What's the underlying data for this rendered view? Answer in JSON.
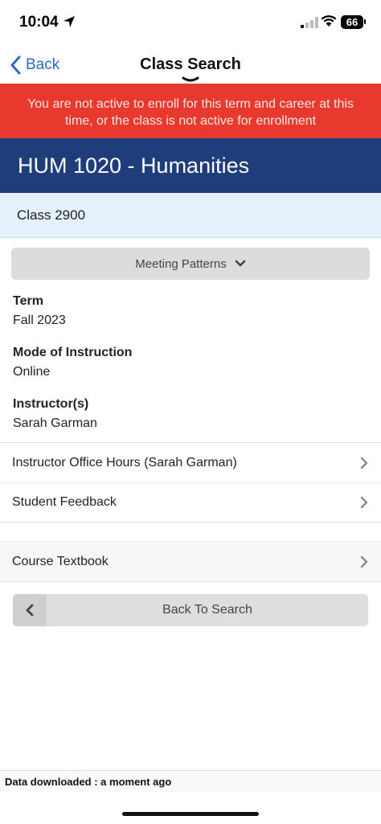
{
  "status": {
    "time": "10:04",
    "battery": "66"
  },
  "nav": {
    "back_label": "Back",
    "title": "Class Search"
  },
  "alert": {
    "message": "You are not active to enroll for this term and career at this time, or the class is not active for enrollment"
  },
  "course": {
    "title": "HUM 1020 - Humanities",
    "class_label": "Class 2900"
  },
  "meeting_patterns": {
    "label": "Meeting Patterns"
  },
  "fields": [
    {
      "label": "Term",
      "value": "Fall 2023"
    },
    {
      "label": "Mode of Instruction",
      "value": "Online"
    },
    {
      "label": "Instructor(s)",
      "value": "Sarah Garman"
    }
  ],
  "links": [
    {
      "label": "Instructor Office Hours (Sarah Garman)"
    },
    {
      "label": "Student Feedback"
    },
    {
      "label": "Course Textbook"
    }
  ],
  "back_to_search": {
    "label": "Back To Search"
  },
  "footer": {
    "text": "Data downloaded : a moment ago"
  },
  "colors": {
    "alert": "#e8392f",
    "course_header": "#1e3d7a",
    "class_row": "#e4f0fa",
    "link_blue": "#2d6ac4"
  }
}
